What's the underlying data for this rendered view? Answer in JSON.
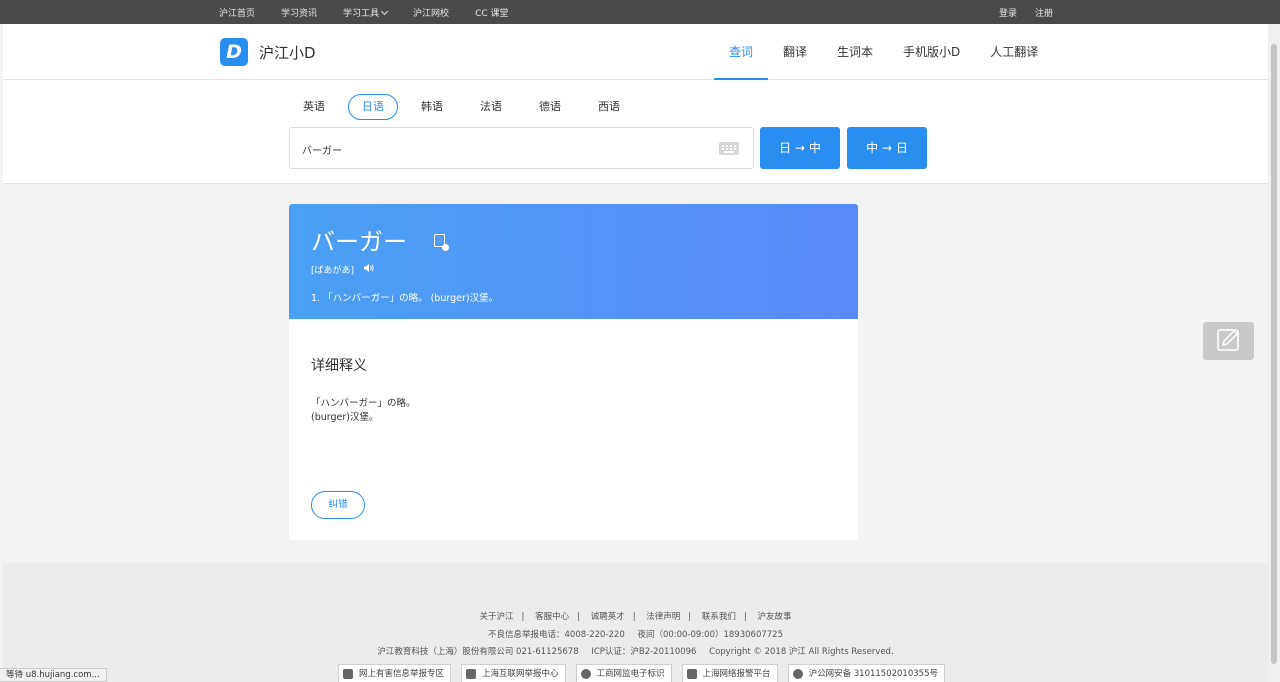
{
  "topnav": {
    "items": [
      "沪江首页",
      "学习资讯",
      "学习工具",
      "沪江网校",
      "CC 课堂"
    ],
    "login": "登录",
    "register": "注册"
  },
  "header": {
    "logo_letter": "D",
    "brand": "沪江小D",
    "tabs": [
      "查词",
      "翻译",
      "生词本",
      "手机版小D",
      "人工翻译"
    ],
    "active_tab": "查词"
  },
  "search": {
    "languages": [
      "英语",
      "日语",
      "韩语",
      "法语",
      "德语",
      "西语"
    ],
    "active_language": "日语",
    "query": "バーガー",
    "btn_jp_cn": "日 → 中",
    "btn_cn_jp": "中 → 日"
  },
  "result": {
    "word": "バーガー",
    "pronunciation": "[ばあがあ]",
    "definition": "1.  「ハンバーガー」の略。 (burger)汉堡。",
    "detail_title": "详细释义",
    "detail_line1": "「ハンバーガー」の略。",
    "detail_line2": "(burger)汉堡。",
    "correct_label": "纠错"
  },
  "footer": {
    "links": [
      "关于沪江",
      "客服中心",
      "诚聘英才",
      "法律声明",
      "联系我们",
      "沪友故事"
    ],
    "report_phone": "不良信息举报电话：4008-220-220",
    "night_phone": "夜间（00:00-09:00）18930607725",
    "company": "沪江教育科技（上海）股份有限公司 021-61125678",
    "icp": "ICP认证：沪B2-20110096",
    "copyright": "Copyright © 2018 沪江 All Rights Reserved.",
    "badges": [
      "网上有害信息举报专区",
      "上海互联网举报中心",
      "工商网监电子标识",
      "上海网络报警平台",
      "沪公网安备 31011502010355号"
    ]
  },
  "status": "等待 u8.hujiang.com...",
  "colors": {
    "accent": "#2a8df0",
    "topbar": "#4a4a4a",
    "card_gradient_start": "#4aa0f2",
    "card_gradient_end": "#5a8af9"
  }
}
